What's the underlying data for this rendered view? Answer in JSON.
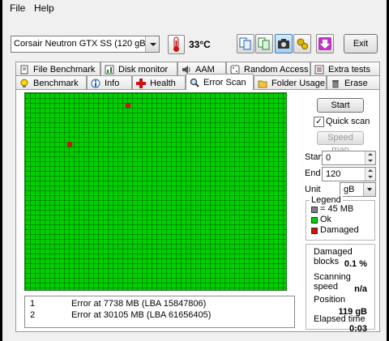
{
  "menu": {
    "file": "File",
    "help": "Help"
  },
  "toolbar": {
    "drive": "Corsair Neutron GTX SS (120 gB)",
    "temperature": "33°C",
    "exit_label": "Exit"
  },
  "tabs_top": [
    {
      "label": "File Benchmark",
      "icon": "page-icon"
    },
    {
      "label": "Disk monitor",
      "icon": "chart-icon"
    },
    {
      "label": "AAM",
      "icon": "speaker-icon"
    },
    {
      "label": "Random Access",
      "icon": "dice-icon"
    },
    {
      "label": "Extra tests",
      "icon": "list-icon"
    }
  ],
  "tabs_bottom": [
    {
      "label": "Benchmark",
      "icon": "bulb-icon"
    },
    {
      "label": "Info",
      "icon": "info-icon"
    },
    {
      "label": "Health",
      "icon": "cross-icon"
    },
    {
      "label": "Error Scan",
      "icon": "magnifier-icon"
    },
    {
      "label": "Folder Usage",
      "icon": "folder-icon"
    },
    {
      "label": "Erase",
      "icon": "trash-icon"
    }
  ],
  "scan": {
    "start_label": "Start",
    "quick_scan_label": "Quick scan",
    "quick_scan_checked": true,
    "speed_map_label": "Speed map",
    "start_field_label": "Start",
    "start_value": "0",
    "end_field_label": "End",
    "end_value": "120",
    "unit_label": "Unit",
    "unit_value": "gB"
  },
  "legend": {
    "title": "Legend",
    "items": [
      {
        "label": "= 45 MB",
        "color": "#808080"
      },
      {
        "label": "Ok",
        "color": "#00d000"
      },
      {
        "label": "Damaged",
        "color": "#d01010"
      }
    ]
  },
  "stats": {
    "damaged_label": "Damaged blocks",
    "damaged_value": "0.1 %",
    "speed_label": "Scanning speed",
    "speed_value": "n/a",
    "position_label": "Position",
    "position_value": "119 gB",
    "elapsed_label": "Elapsed time",
    "elapsed_value": "0:03"
  },
  "grid": {
    "ok_color": "#00d000",
    "damaged_color": "#d01010"
  },
  "log": [
    {
      "num": "1",
      "text": "Error at 7738 MB (LBA 15847806)"
    },
    {
      "num": "2",
      "text": "Error at 30105 MB (LBA 61656405)"
    }
  ]
}
